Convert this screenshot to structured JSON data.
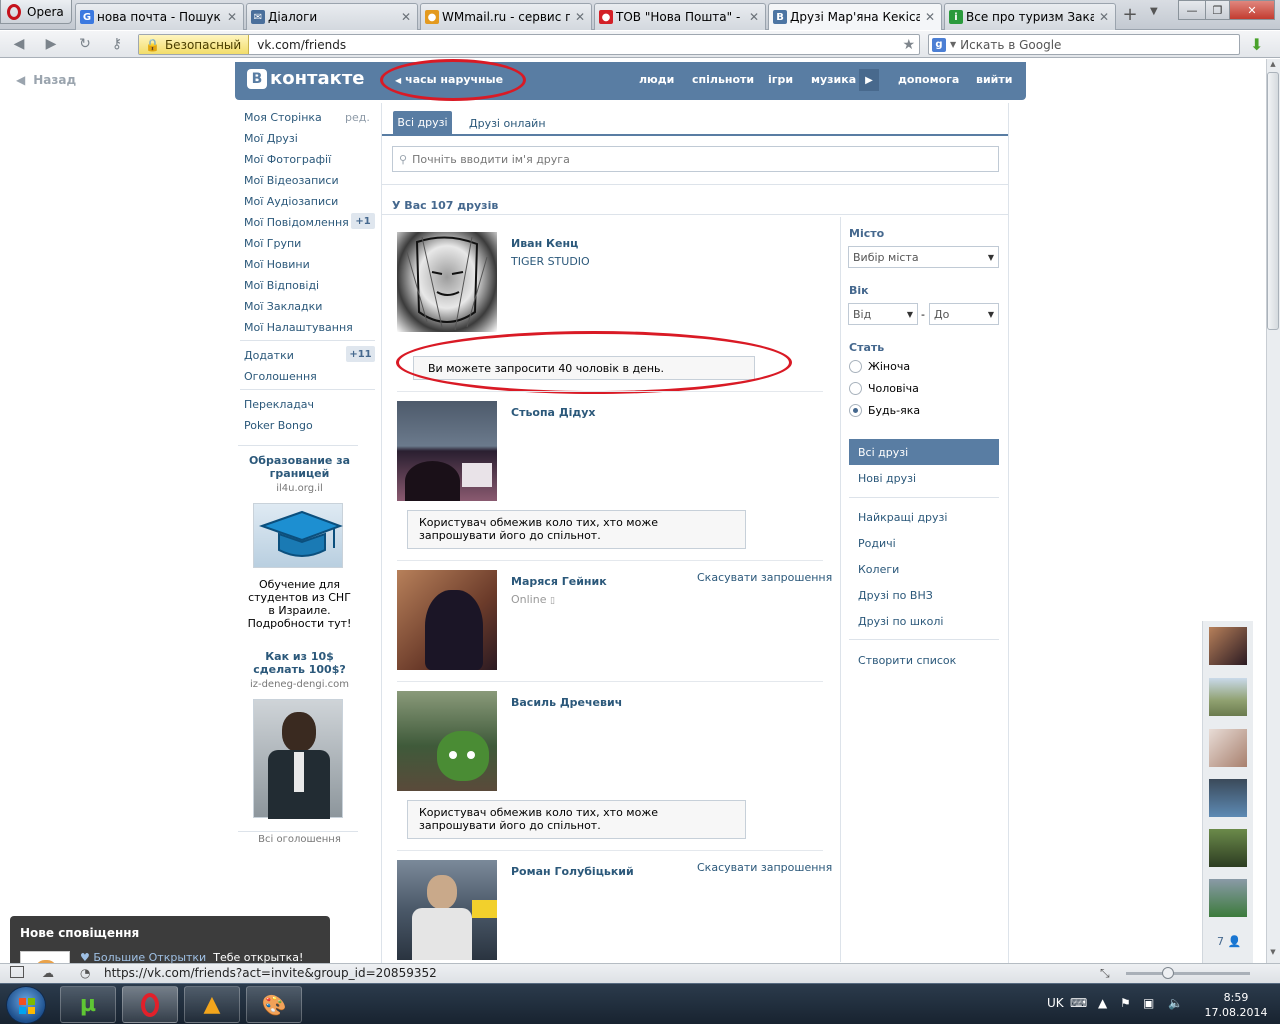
{
  "browser": {
    "menu_label": "Opera",
    "tabs": [
      {
        "title": "нова почта - Пошук G...",
        "fav": "G",
        "fav_color": "#3b79e0"
      },
      {
        "title": "Діалоги",
        "fav": "✉",
        "fav_color": "#4a6f9b"
      },
      {
        "title": "WMmail.ru - сервис п...",
        "fav": "●",
        "fav_color": "#e39a1f"
      },
      {
        "title": "ТОВ \"Нова Пошта\" - ...",
        "fav": "●",
        "fav_color": "#d32027"
      },
      {
        "title": "Друзі Мар'яна Кекіса |...",
        "fav": "В",
        "fav_color": "#4c75a3"
      },
      {
        "title": "Все про туризм Закар...",
        "fav": "i",
        "fav_color": "#2a9a3c"
      }
    ],
    "security_label": "Безопасный",
    "url": "vk.com/friends",
    "search_placeholder": "Искать в Google"
  },
  "page": {
    "back_label": "Назад",
    "logo_text": "контакте",
    "logo_letter": "В",
    "breadcrumb": "часы наручные",
    "nav": [
      "люди",
      "спільноти",
      "ігри",
      "музика",
      "допомога",
      "вийти"
    ],
    "left_menu": {
      "items": [
        "Моя Сторінка",
        "Мої Друзі",
        "Мої Фотографії",
        "Мої Відеозаписи",
        "Мої Аудіозаписи",
        "Мої Повідомлення",
        "Мої Групи",
        "Мої Новини",
        "Мої Відповіді",
        "Мої Закладки",
        "Мої Налаштування"
      ],
      "edit_label": "ред.",
      "messages_badge": "+1",
      "apps_label": "Додатки",
      "apps_badge": "+11",
      "ads_label": "Оголошення",
      "translator_label": "Перекладач",
      "poker_label": "Poker Bongo"
    },
    "ads": [
      {
        "title": "Образование за границей",
        "domain": "il4u.org.il",
        "text": "Обучение для студентов из СНГ в Израиле. Подробности тут!"
      },
      {
        "title": "Как из 10$ сделать 100$?",
        "domain": "iz-deneg-dengi.com"
      }
    ],
    "all_ads_label": "Всі оголошення",
    "tabs": {
      "all": "Всі друзі",
      "online": "Друзі онлайн"
    },
    "search_placeholder": "Почніть вводити ім'я друга",
    "friends_count": "У Вас 107 друзів",
    "invite_limit": "Ви можете запросити 40 чоловік в день.",
    "friends": [
      {
        "name": "Иван Кенц",
        "sub": "TIGER STUDIO"
      },
      {
        "name": "Стьопа Дідух",
        "notice": "Користувач обмежив коло тих, хто може запрошувати його до спільнот."
      },
      {
        "name": "Маряся Гейник",
        "status": "Online",
        "action": "Скасувати запрошення"
      },
      {
        "name": "Василь Дречевич",
        "notice": "Користувач обмежив коло тих, хто може запрошувати його до спільнот."
      },
      {
        "name": "Роман Голубіцький",
        "action": "Скасувати запрошення"
      }
    ],
    "filters": {
      "city_label": "Місто",
      "city_select": "Вибір міста",
      "age_label": "Вік",
      "age_from": "Від",
      "age_dash": "-",
      "age_to": "До",
      "sex_label": "Стать",
      "sex_options": [
        "Жіноча",
        "Чоловіча",
        "Будь-яка"
      ],
      "sex_selected": "Будь-яка",
      "lists": [
        "Всі друзі",
        "Нові друзі",
        "Найкращі друзі",
        "Родичі",
        "Колеги",
        "Друзі по ВНЗ",
        "Друзі по школі",
        "Створити список"
      ]
    },
    "online_count": "7"
  },
  "notification": {
    "title": "Нове сповіщення",
    "link": "♥ Большие Открытки",
    "text": "Тебе открытка!"
  },
  "status_url": "https://vk.com/friends?act=invite&group_id=20859352",
  "tray": {
    "lang": "UK",
    "time": "8:59",
    "date": "17.08.2014"
  },
  "colors": {
    "vk_blue": "#597da3",
    "link": "#2b587a",
    "annotation_red": "#d91a25"
  }
}
